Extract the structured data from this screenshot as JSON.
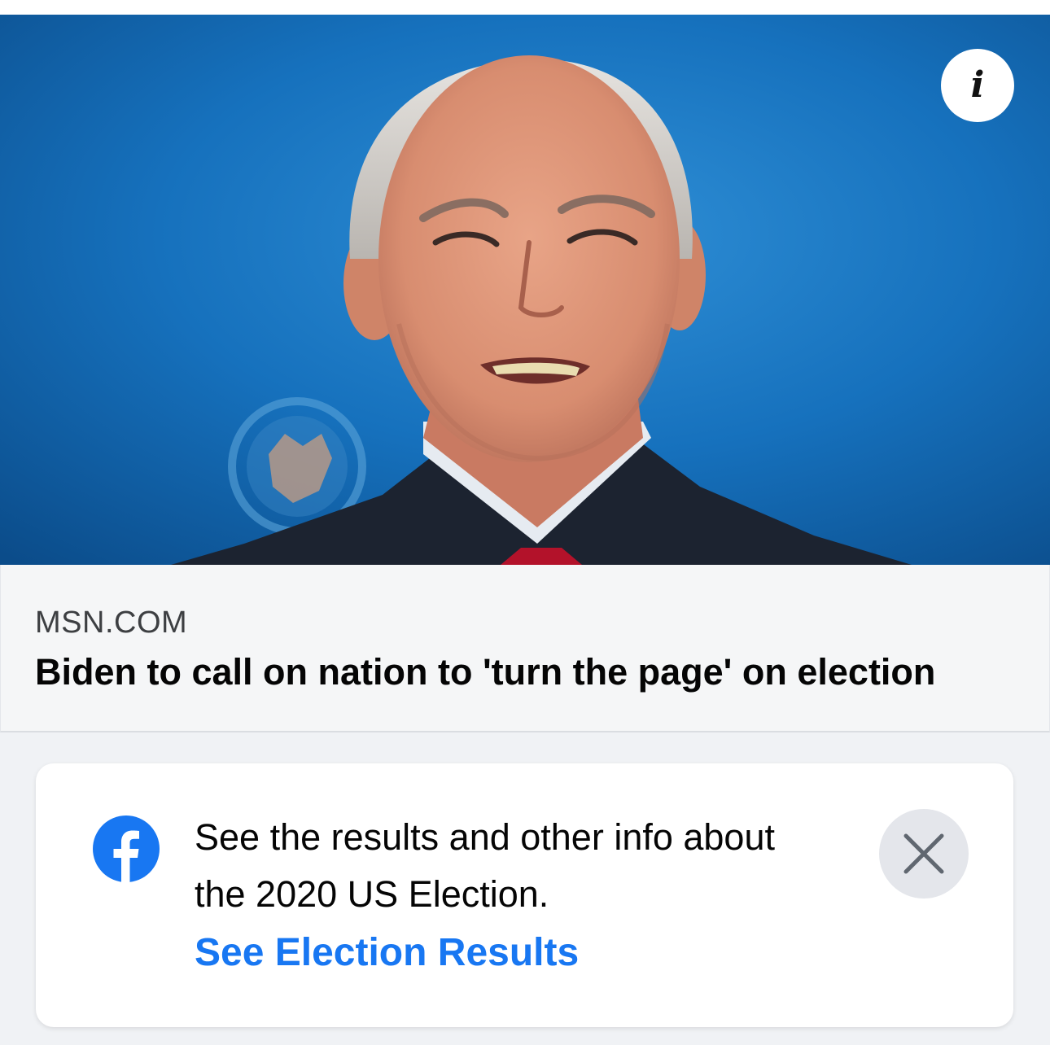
{
  "link_preview": {
    "image_alt": "Man in dark suit and red tie speaking in front of a blue backdrop",
    "info_icon": "info-icon",
    "source": "MSN.COM",
    "headline": "Biden to call on nation to 'turn the page' on election"
  },
  "election_notice": {
    "icon": "facebook-icon",
    "message": "See the results and other info about the 2020 US Election.",
    "link_label": "See Election Results",
    "close_icon": "close-icon"
  },
  "colors": {
    "facebook_blue": "#1877f2",
    "hero_blue": "#1670bb",
    "caption_bg": "#f5f6f7",
    "close_bg": "#e4e6eb"
  }
}
